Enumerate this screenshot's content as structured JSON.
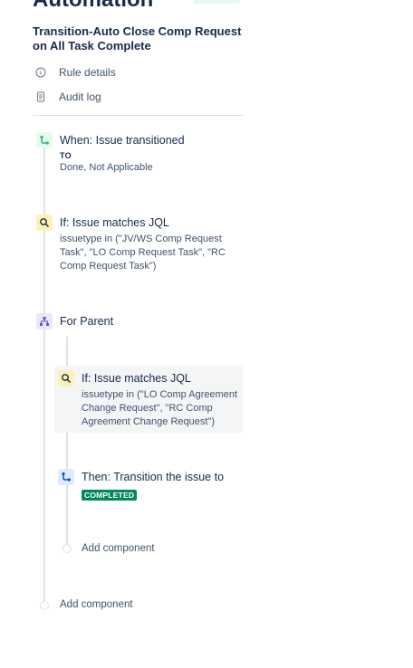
{
  "header": {
    "app_title": "Automation",
    "rule_name": "Transition-Auto Close Comp Request on All Task Complete"
  },
  "meta_links": [
    {
      "label": "Rule details",
      "icon": "info-icon"
    },
    {
      "label": "Audit log",
      "icon": "document-icon"
    }
  ],
  "nodes": {
    "trigger": {
      "title": "When: Issue transitioned",
      "to_label": "TO",
      "value": "Done, Not Applicable",
      "icon": "transition-icon"
    },
    "condition1": {
      "title": "If: Issue matches JQL",
      "jql": "issuetype in (\"JV/WS Comp Request Task\", \"LO Comp Request Task\", \"RC Comp Request Task\")",
      "icon": "search-icon"
    },
    "branch": {
      "title": "For Parent",
      "icon": "branch-icon"
    },
    "condition2": {
      "title": "If: Issue matches JQL",
      "jql": "issuetype in (\"LO Comp Agreement Change Request\", \"RC Comp Agreement Change Request\")",
      "icon": "search-icon"
    },
    "action": {
      "title": "Then: Transition the issue to",
      "status": "COMPLETED",
      "icon": "transition-icon"
    }
  },
  "add_component": {
    "nested_label": "Add component",
    "root_label": "Add component"
  },
  "colors": {
    "green": "#36b37e",
    "yellow_bg": "#fff0b3",
    "purple": "#6554c0",
    "status_green": "#00875a"
  }
}
